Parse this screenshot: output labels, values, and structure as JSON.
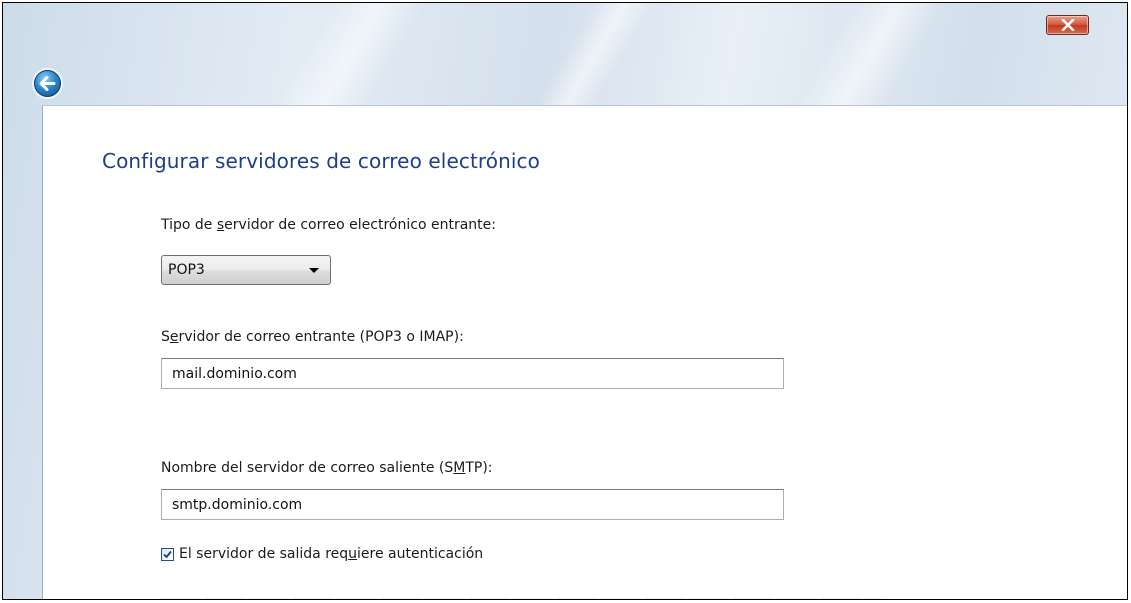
{
  "window": {
    "close_icon": "close-x-icon",
    "back_icon": "back-arrow-icon"
  },
  "page": {
    "title": "Configurar servidores de correo electrónico"
  },
  "form": {
    "server_type": {
      "label_pre": "Tipo de ",
      "label_key": "s",
      "label_post": "ervidor de correo electrónico entrante:",
      "value": "POP3",
      "options": [
        "POP3"
      ]
    },
    "incoming": {
      "label_pre": "S",
      "label_key": "e",
      "label_post": "rvidor de correo entrante (POP3 o IMAP):",
      "value": "mail.dominio.com"
    },
    "outgoing": {
      "label_pre": "Nombre del servidor de correo saliente (S",
      "label_key": "M",
      "label_post": "TP):",
      "value": "smtp.dominio.com"
    },
    "auth": {
      "label_pre": "El servidor de salida req",
      "label_key": "u",
      "label_post": "iere autenticación",
      "checked": true
    }
  },
  "colors": {
    "title": "#1e3e8c",
    "close_button": "#c8442a",
    "back_button": "#2b87cc"
  }
}
